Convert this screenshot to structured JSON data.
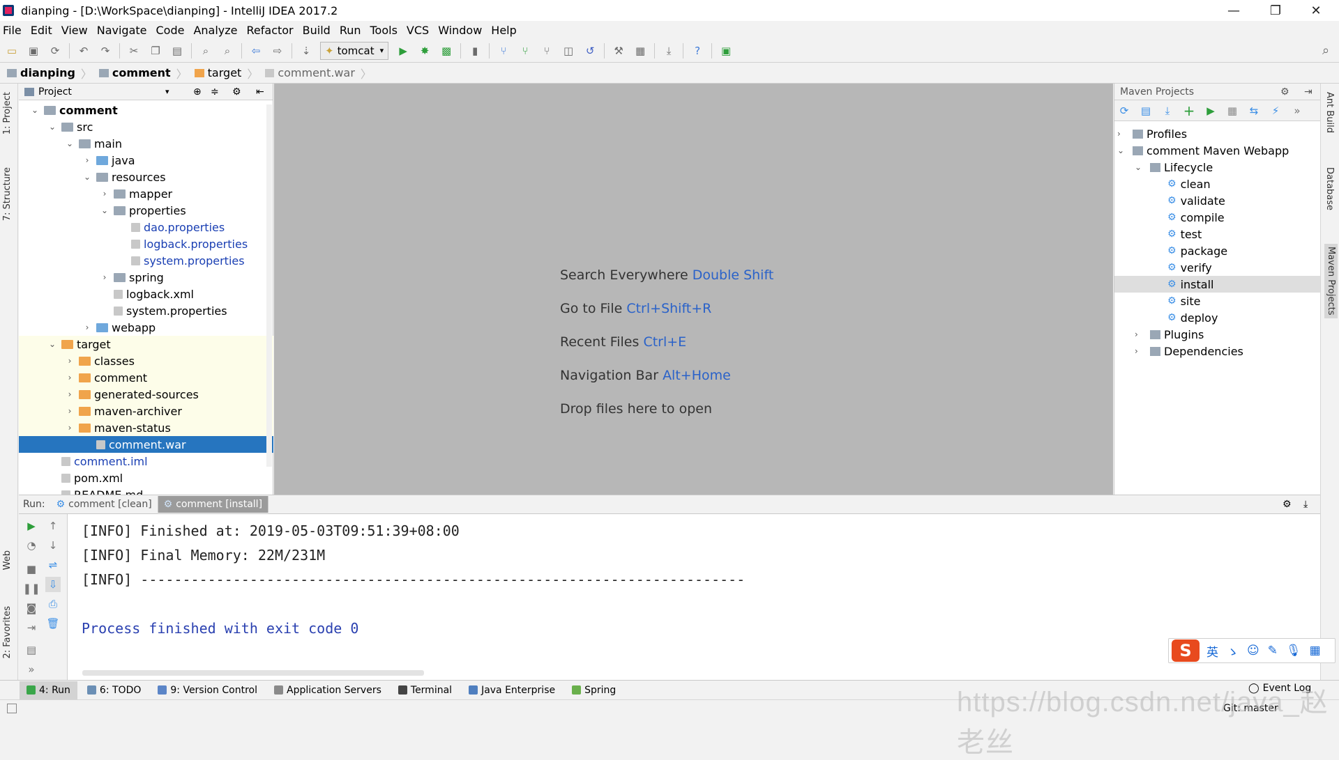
{
  "window": {
    "title": "dianping - [D:\\WorkSpace\\dianping] - IntelliJ IDEA 2017.2",
    "minimize": "—",
    "restore": "❐",
    "close": "✕"
  },
  "menu": [
    "File",
    "Edit",
    "View",
    "Navigate",
    "Code",
    "Analyze",
    "Refactor",
    "Build",
    "Run",
    "Tools",
    "VCS",
    "Window",
    "Help"
  ],
  "toolbar": {
    "run_config": "tomcat"
  },
  "breadcrumb": [
    "dianping",
    "comment",
    "target",
    "comment.war"
  ],
  "left_tabs": {
    "project": "1: Project",
    "structure": "7: Structure",
    "web": "Web",
    "favorites": "2: Favorites"
  },
  "right_tabs": {
    "ant": "Ant Build",
    "database": "Database",
    "maven": "Maven Projects"
  },
  "project_panel": {
    "title": "Project",
    "tree": [
      {
        "label": "comment",
        "depth": 0,
        "arrow": "v",
        "icon": "fold",
        "bold": true
      },
      {
        "label": "src",
        "depth": 1,
        "arrow": "v",
        "icon": "fold"
      },
      {
        "label": "main",
        "depth": 2,
        "arrow": "v",
        "icon": "fold"
      },
      {
        "label": "java",
        "depth": 3,
        "arrow": ">",
        "icon": "fold-b"
      },
      {
        "label": "resources",
        "depth": 3,
        "arrow": "v",
        "icon": "fold"
      },
      {
        "label": "mapper",
        "depth": 4,
        "arrow": ">",
        "icon": "fold"
      },
      {
        "label": "properties",
        "depth": 4,
        "arrow": "v",
        "icon": "fold"
      },
      {
        "label": "dao.properties",
        "depth": 5,
        "arrow": "",
        "icon": "file",
        "blue": true
      },
      {
        "label": "logback.properties",
        "depth": 5,
        "arrow": "",
        "icon": "file",
        "blue": true
      },
      {
        "label": "system.properties",
        "depth": 5,
        "arrow": "",
        "icon": "file",
        "blue": true
      },
      {
        "label": "spring",
        "depth": 4,
        "arrow": ">",
        "icon": "fold"
      },
      {
        "label": "logback.xml",
        "depth": 4,
        "arrow": "",
        "icon": "file"
      },
      {
        "label": "system.properties",
        "depth": 4,
        "arrow": "",
        "icon": "file"
      },
      {
        "label": "webapp",
        "depth": 3,
        "arrow": ">",
        "icon": "fold-b"
      },
      {
        "label": "target",
        "depth": 1,
        "arrow": "v",
        "icon": "fold-o",
        "excluded": true
      },
      {
        "label": "classes",
        "depth": 2,
        "arrow": ">",
        "icon": "fold-o",
        "excluded": true
      },
      {
        "label": "comment",
        "depth": 2,
        "arrow": ">",
        "icon": "fold-o",
        "excluded": true
      },
      {
        "label": "generated-sources",
        "depth": 2,
        "arrow": ">",
        "icon": "fold-o",
        "excluded": true
      },
      {
        "label": "maven-archiver",
        "depth": 2,
        "arrow": ">",
        "icon": "fold-o",
        "excluded": true
      },
      {
        "label": "maven-status",
        "depth": 2,
        "arrow": ">",
        "icon": "fold-o",
        "excluded": true
      },
      {
        "label": "comment.war",
        "depth": 3,
        "arrow": "",
        "icon": "file",
        "selected": true
      },
      {
        "label": "comment.iml",
        "depth": 1,
        "arrow": "",
        "icon": "file",
        "blue": true
      },
      {
        "label": "pom.xml",
        "depth": 1,
        "arrow": "",
        "icon": "file"
      },
      {
        "label": "README.md",
        "depth": 1,
        "arrow": "",
        "icon": "file"
      }
    ]
  },
  "editor_hints": [
    {
      "text": "Search Everywhere",
      "key": "Double Shift"
    },
    {
      "text": "Go to File",
      "key": "Ctrl+Shift+R"
    },
    {
      "text": "Recent Files",
      "key": "Ctrl+E"
    },
    {
      "text": "Navigation Bar",
      "key": "Alt+Home"
    },
    {
      "text": "Drop files here to open",
      "key": ""
    }
  ],
  "maven_panel": {
    "title": "Maven Projects",
    "tree": [
      {
        "label": "Profiles",
        "depth": 0,
        "arrow": ">"
      },
      {
        "label": "comment Maven Webapp",
        "depth": 0,
        "arrow": "v"
      },
      {
        "label": "Lifecycle",
        "depth": 1,
        "arrow": "v"
      },
      {
        "label": "clean",
        "depth": 2,
        "arrow": "",
        "gear": true
      },
      {
        "label": "validate",
        "depth": 2,
        "arrow": "",
        "gear": true
      },
      {
        "label": "compile",
        "depth": 2,
        "arrow": "",
        "gear": true
      },
      {
        "label": "test",
        "depth": 2,
        "arrow": "",
        "gear": true
      },
      {
        "label": "package",
        "depth": 2,
        "arrow": "",
        "gear": true
      },
      {
        "label": "verify",
        "depth": 2,
        "arrow": "",
        "gear": true
      },
      {
        "label": "install",
        "depth": 2,
        "arrow": "",
        "gear": true,
        "highlight": true
      },
      {
        "label": "site",
        "depth": 2,
        "arrow": "",
        "gear": true
      },
      {
        "label": "deploy",
        "depth": 2,
        "arrow": "",
        "gear": true
      },
      {
        "label": "Plugins",
        "depth": 1,
        "arrow": ">"
      },
      {
        "label": "Dependencies",
        "depth": 1,
        "arrow": ">"
      }
    ]
  },
  "run": {
    "label": "Run:",
    "tabs": [
      "comment [clean]",
      "comment [install]"
    ],
    "active_tab": 1
  },
  "console": [
    {
      "text": "[INFO] Finished at: 2019-05-03T09:51:39+08:00",
      "color": "#222222"
    },
    {
      "text": "[INFO] Final Memory: 22M/231M",
      "color": "#222222"
    },
    {
      "text": "[INFO] ------------------------------------------------------------------------",
      "color": "#222222"
    },
    {
      "text": "",
      "color": "#222222"
    },
    {
      "text": "Process finished with exit code 0",
      "color": "#2a40b0"
    }
  ],
  "bottom_tabs": [
    {
      "label": "4: Run",
      "active": true,
      "color": "#3aa64a"
    },
    {
      "label": "6: TODO",
      "color": "#6b8fb5"
    },
    {
      "label": "9: Version Control",
      "color": "#5b85c7"
    },
    {
      "label": "Application Servers",
      "color": "#8a8a8a"
    },
    {
      "label": "Terminal",
      "color": "#444444"
    },
    {
      "label": "Java Enterprise",
      "color": "#4f7fbf"
    },
    {
      "label": "Spring",
      "color": "#6ab04c"
    }
  ],
  "status": {
    "event_log": "Event Log",
    "git": "Git: master"
  },
  "ime": {
    "lang": "英"
  },
  "watermark": "https://blog.csdn.net/java_赵老丝"
}
